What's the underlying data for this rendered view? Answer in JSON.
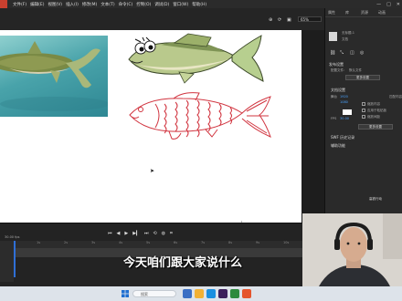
{
  "menubar": {
    "items": [
      "文件(F)",
      "编辑(E)",
      "视图(V)",
      "插入(I)",
      "修改(M)",
      "文本(T)",
      "命令(C)",
      "控制(O)",
      "调试(D)",
      "窗口(W)",
      "帮助(H)"
    ]
  },
  "window_controls": {
    "minimize": "—",
    "maximize": "□",
    "close": "✕"
  },
  "toolbar": {
    "zoom_value": "65%"
  },
  "panel": {
    "tabs": [
      "属性",
      "库",
      "资源",
      "动画"
    ],
    "doc_label": "文档",
    "doc_name": "无标题-1",
    "publish_section": "发布设置",
    "profile_label": "配置文件:",
    "profile_value": "默认文件",
    "more_settings": "更多设置",
    "doc_settings_section": "文档设置",
    "size_label": "舞台",
    "width_value": "1920",
    "height_value": "1080",
    "match_content": "匹配内容",
    "scale_content": "缩放内容",
    "apply_to_pasteboard": "应用于粘贴板",
    "scale_spacing": "缩放间距",
    "fps_label": "FPS",
    "fps_value": "30.00",
    "more_settings2": "更多设置",
    "swf_history": "SWF 历史记录",
    "accessibility": "辅助功能",
    "side_note": "高铁行动"
  },
  "timeline": {
    "fps": "30.00 fps",
    "frame_ticks": [
      "1s",
      "2s",
      "3s",
      "4s",
      "5s",
      "6s",
      "7s",
      "8s",
      "9s",
      "10s"
    ]
  },
  "subtitle": "今天咱们跟大家说什么",
  "taskbar": {
    "search_placeholder": "搜索",
    "tray_time": "10:24",
    "tray_date": "2023/7/5"
  },
  "colors": {
    "brand": "#d4402e",
    "stage_bg": "#ffffff",
    "line_fish": "#d1343f",
    "cartoon_fish_body": "#8fae6a"
  }
}
